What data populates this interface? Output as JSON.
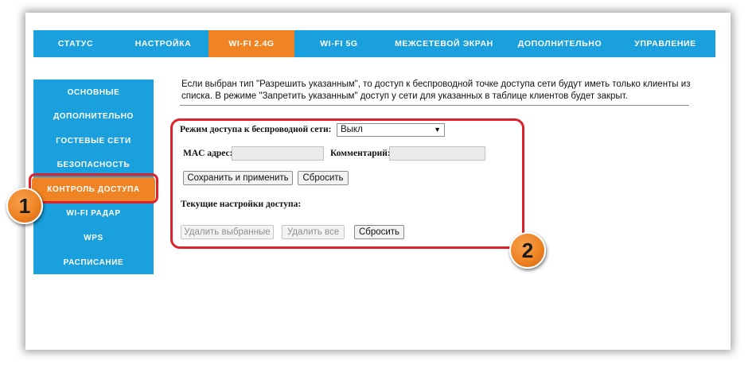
{
  "topnav": {
    "tabs": [
      {
        "label": "Статус"
      },
      {
        "label": "Настройка"
      },
      {
        "label": "Wi-Fi 2.4G"
      },
      {
        "label": "Wi-Fi 5G"
      },
      {
        "label": "Межсетевой экран"
      },
      {
        "label": "Дополнительно"
      },
      {
        "label": "Управление"
      }
    ],
    "active": "Wi-Fi 2.4G"
  },
  "sidebar": {
    "items": [
      {
        "label": "Основные"
      },
      {
        "label": "Дополнительно"
      },
      {
        "label": "Гостевые сети"
      },
      {
        "label": "Безопасность"
      },
      {
        "label": "Контроль доступа"
      },
      {
        "label": "Wi-Fi радар"
      },
      {
        "label": "WPS"
      },
      {
        "label": "Расписание"
      }
    ],
    "active": "Контроль доступа"
  },
  "info_text": "Если выбран тип \"Разрешить указанным\", то доступ к беспроводной точке доступа сети будут иметь только клиенты из списка. В режиме \"Запретить указанным\" доступ у сети для указанных в таблице клиентов будет закрыт.",
  "form": {
    "access_mode_label": "Режим доступа к беспроводной сети:",
    "access_mode_value": "Выкл",
    "mac_label": "MAC адрес:",
    "mac_value": "",
    "comment_label": "Комментарий:",
    "comment_value": "",
    "save_apply_label": "Сохранить и применить",
    "reset_label": "Сбросить",
    "current_settings_label": "Текущие настройки доступа:",
    "delete_selected_label": "Удалить выбранные",
    "delete_all_label": "Удалить все",
    "reset2_label": "Сбросить"
  },
  "annotations": {
    "badge1": "1",
    "badge2": "2"
  },
  "colors": {
    "nav_blue": "#1aa0dc",
    "active_orange": "#f08424",
    "highlight_red": "#e0202a"
  },
  "icons": {
    "select_arrow": "chevron-down-icon"
  }
}
